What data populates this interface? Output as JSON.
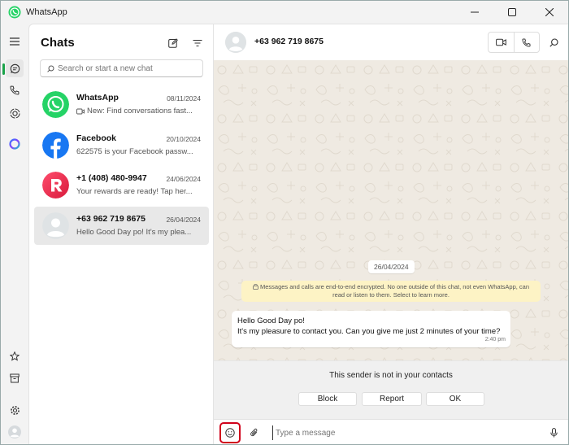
{
  "window": {
    "title": "WhatsApp",
    "controls": [
      "minimize",
      "maximize",
      "close"
    ]
  },
  "colors": {
    "brand_green": "#25D366",
    "accent_green": "#1aa34a",
    "facebook_blue": "#1877F2",
    "rewards_red": "#E8344E",
    "encryption_notice_bg": "#fdf3c5",
    "highlight_red": "#d0021b"
  },
  "rail": {
    "top": [
      "menu-icon",
      "chats-icon",
      "calls-icon",
      "status-icon",
      "meta-ai-icon"
    ],
    "bottom": [
      "starred-icon",
      "archived-icon",
      "settings-icon",
      "profile-icon"
    ]
  },
  "sidebar": {
    "title": "Chats",
    "search_placeholder": "Search or start a new chat",
    "chats": [
      {
        "name": "WhatsApp",
        "date": "08/11/2024",
        "preview": "New: Find conversations fast..."
      },
      {
        "name": "Facebook",
        "date": "20/10/2024",
        "preview": "622575 is your Facebook passw..."
      },
      {
        "name": "+1 (408) 480-9947",
        "date": "24/06/2024",
        "preview": "Your rewards are ready! Tap her..."
      },
      {
        "name": "+63 962 719 8675",
        "date": "26/04/2024",
        "preview": "Hello Good Day po! It's my plea..."
      }
    ]
  },
  "conversation": {
    "contact": "+63 962 719 8675",
    "date_divider": "26/04/2024",
    "encryption_notice": "Messages and calls are end-to-end encrypted. No one outside of this chat, not even WhatsApp, can read or listen to them. Select to learn more.",
    "messages": [
      {
        "line1": "Hello Good Day po!",
        "line2": "It's my pleasure to contact you. Can you give me just 2 minutes of your time?",
        "time": "2:40 pm"
      }
    ]
  },
  "unknown_sender": {
    "text": "This sender is not in your contacts",
    "block": "Block",
    "report": "Report",
    "ok": "OK"
  },
  "composer": {
    "placeholder": "Type a message"
  }
}
